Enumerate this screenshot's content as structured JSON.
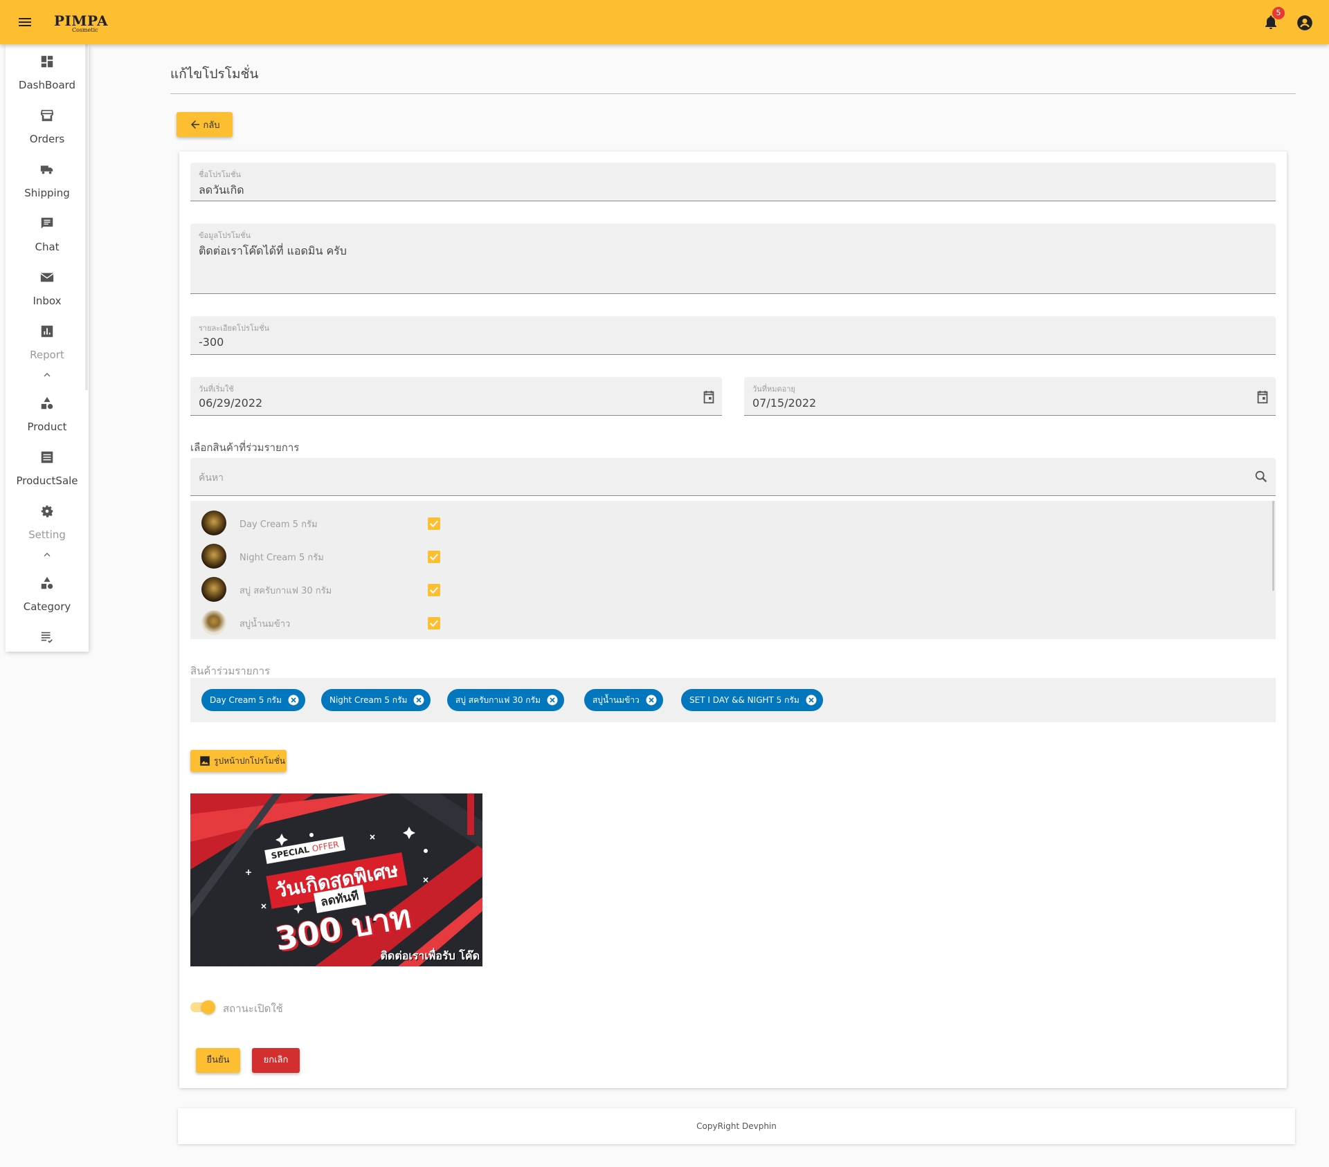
{
  "brand": {
    "name": "PIMPA",
    "tagline": "Cosmetic"
  },
  "header": {
    "notification_count": "5"
  },
  "sidebar": {
    "items": [
      {
        "label": "DashBoard",
        "icon": "dashboard-icon"
      },
      {
        "label": "Orders",
        "icon": "store-icon"
      },
      {
        "label": "Shipping",
        "icon": "truck-icon"
      },
      {
        "label": "Chat",
        "icon": "chat-icon"
      },
      {
        "label": "Inbox",
        "icon": "mail-icon"
      },
      {
        "label": "Report",
        "icon": "chart-icon"
      },
      {
        "label": "Product",
        "icon": "shapes-icon"
      },
      {
        "label": "ProductSale",
        "icon": "list-icon"
      },
      {
        "label": "Setting",
        "icon": "gear-icon"
      },
      {
        "label": "Category",
        "icon": "shapes-icon"
      }
    ]
  },
  "page": {
    "title": "แก้ไขโปรโมชั่น",
    "back_label": "กลับ"
  },
  "form": {
    "name": {
      "label": "ชื่อโปรโมชั่น",
      "value": "ลดวันเกิด"
    },
    "info": {
      "label": "ข้อมูลโปรโมชั่น",
      "value": "ติดต่อเราโค๊ดได้ที่ แอดมิน ครับ"
    },
    "detail": {
      "label": "รายละเอียดโปรโมชั่น",
      "value": "-300"
    },
    "start_date": {
      "label": "วันที่เริ่มใช้",
      "value": "06/29/2022"
    },
    "end_date": {
      "label": "วันที่หมดอายุ",
      "value": "07/15/2022"
    },
    "select_label": "เลือกสินค้าที่ร่วมรายการ",
    "search_placeholder": "ค้นหา",
    "products": [
      {
        "name": "Day Cream 5 กรัม",
        "checked": true
      },
      {
        "name": "Night Cream 5 กรัม",
        "checked": true
      },
      {
        "name": "สบู่ สครับกาแฟ 30 กรัม",
        "checked": true
      },
      {
        "name": "สบู่น้ำนมข้าว",
        "checked": true
      }
    ],
    "joined_label": "สินค้าร่วมรายการ",
    "chips": [
      "Day Cream 5 กรัม",
      "Night Cream 5 กรัม",
      "สบู่ สครับกาแฟ 30 กรัม",
      "สบู่น้ำนมข้าว",
      "SET I DAY && NIGHT 5 กรัม"
    ],
    "image_button": "รูปหน้าปกโปรโมชั่น",
    "banner": {
      "special": "SPECIAL",
      "offer": "OFFER",
      "title": "วันเกิดสุดพิเศษ",
      "subtitle": "ลดทันที",
      "price": "300 บาท",
      "cta": "ติดต่อเราเพื่อรับ โค๊ด"
    },
    "status_label": "สถานะเปิดใช้",
    "status_on": true,
    "confirm_label": "ยืนยัน",
    "cancel_label": "ยกเลิก"
  },
  "footer": {
    "text": "CopyRight Devphin"
  },
  "colors": {
    "accent": "#fdbe31",
    "chip": "#0277bd",
    "danger": "#d32f2f"
  }
}
